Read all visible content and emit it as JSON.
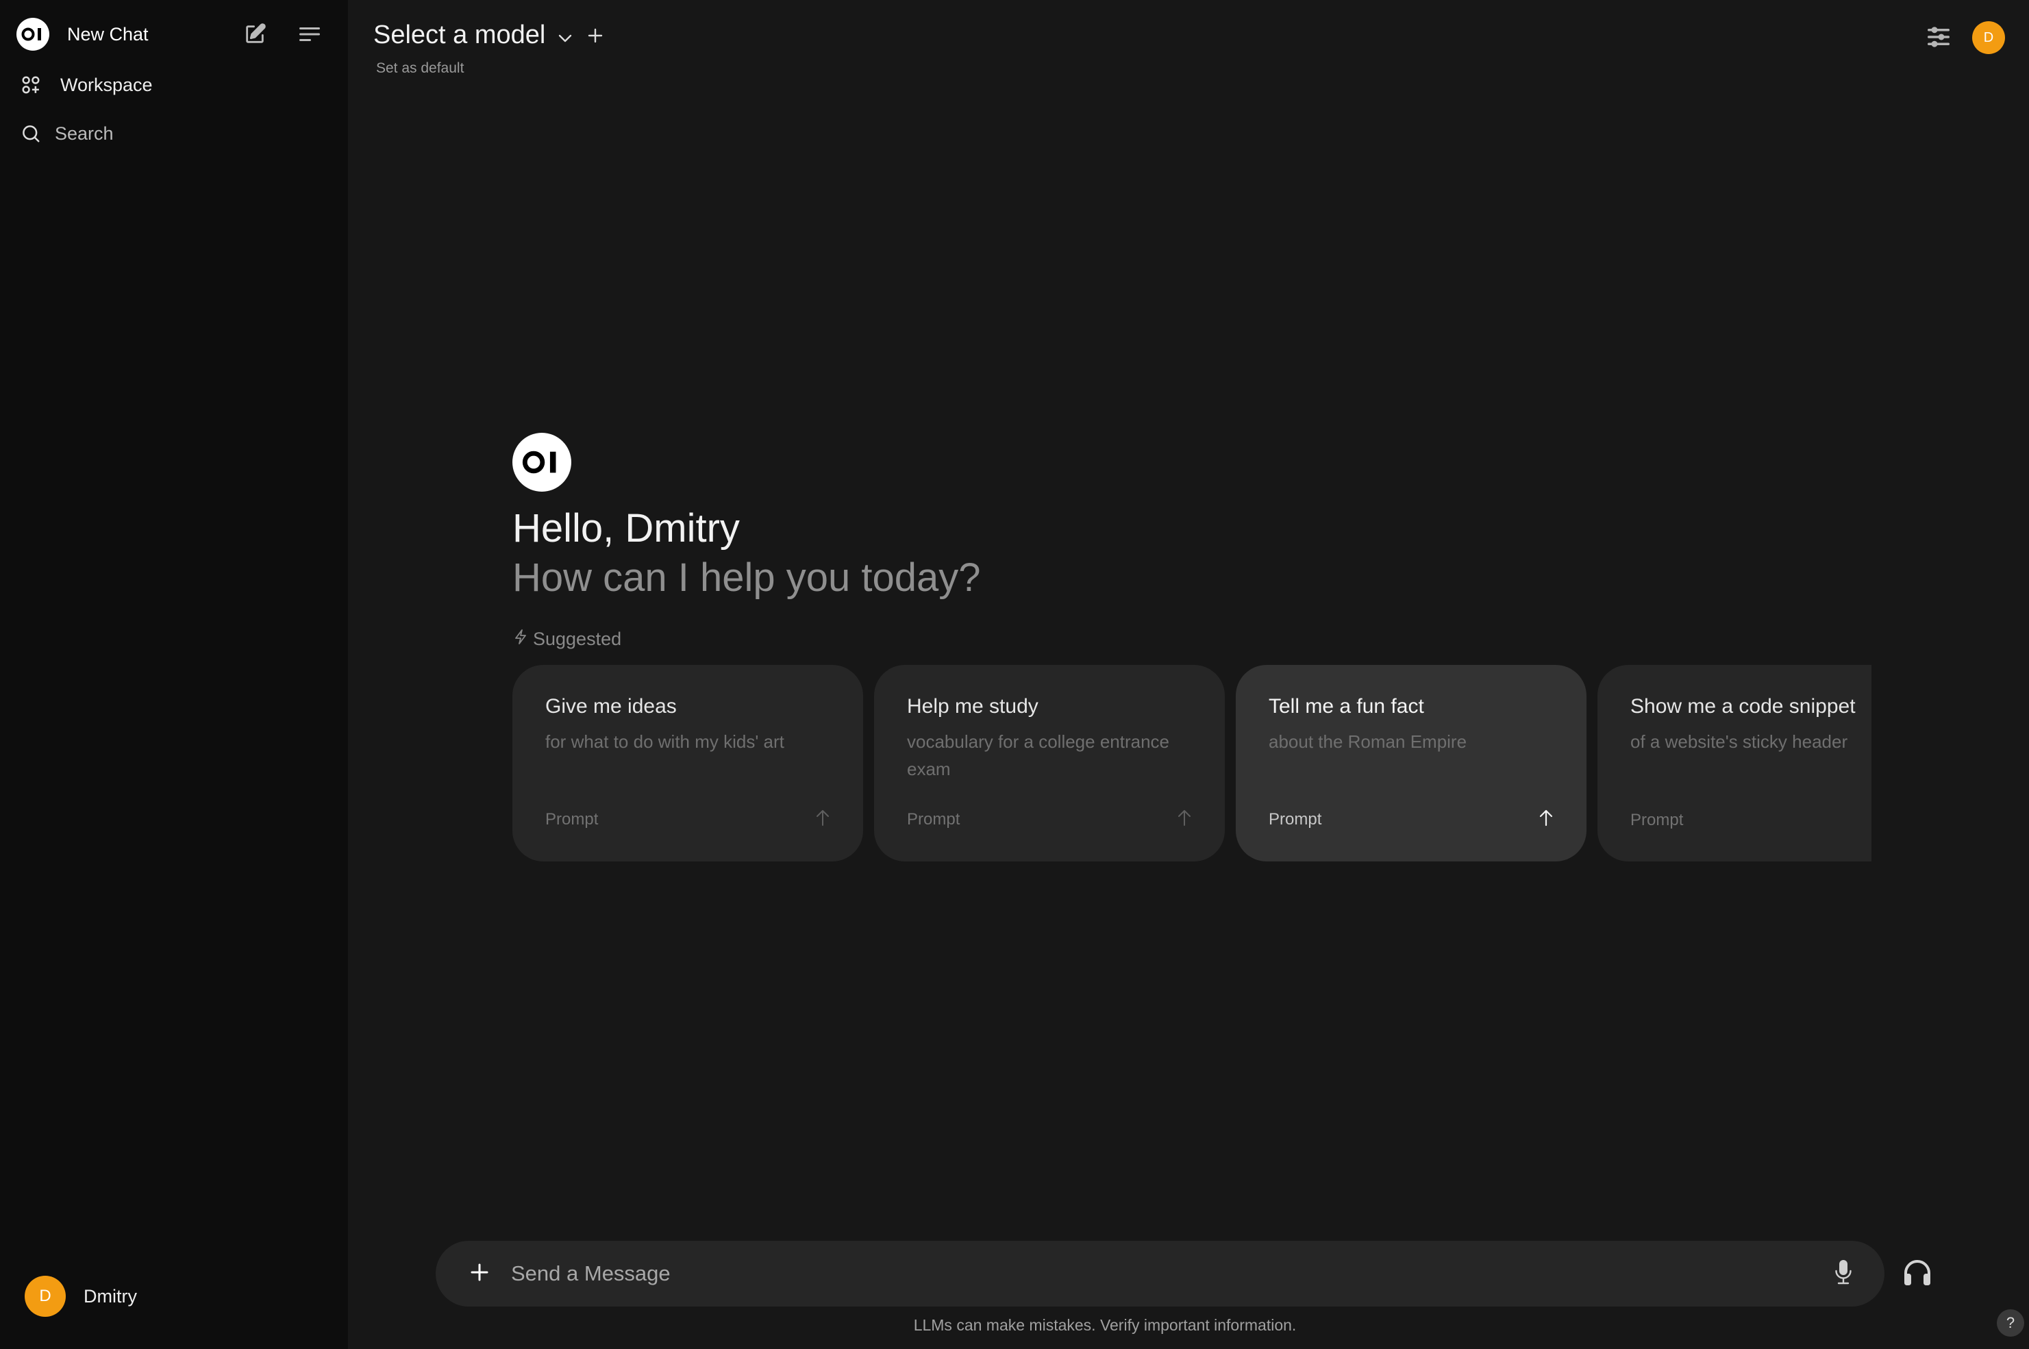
{
  "sidebar": {
    "new_chat_label": "New Chat",
    "items": [
      {
        "label": "Workspace",
        "icon": "workspace-icon"
      },
      {
        "label": "Search",
        "icon": "search-icon"
      }
    ],
    "user": {
      "name": "Dmitry",
      "initial": "D"
    }
  },
  "header": {
    "model_selector_label": "Select a model",
    "set_default_label": "Set as default",
    "user_initial": "D"
  },
  "welcome": {
    "greeting": "Hello, Dmitry",
    "subtitle": "How can I help you today?",
    "suggested_label": "Suggested"
  },
  "suggestions": [
    {
      "title": "Give me ideas",
      "subtitle": "for what to do with my kids' art",
      "tag": "Prompt"
    },
    {
      "title": "Help me study",
      "subtitle": "vocabulary for a college entrance exam",
      "tag": "Prompt"
    },
    {
      "title": "Tell me a fun fact",
      "subtitle": "about the Roman Empire",
      "tag": "Prompt"
    },
    {
      "title": "Show me a code snippet",
      "subtitle": "of a website's sticky header",
      "tag": "Prompt"
    }
  ],
  "composer": {
    "placeholder": "Send a Message",
    "value": ""
  },
  "footer": {
    "disclaimer": "LLMs can make mistakes. Verify important information.",
    "help_label": "?"
  },
  "colors": {
    "avatar": "#f39c12",
    "sidebar_bg": "#0d0d0d",
    "main_bg": "#171717",
    "card_bg": "#262626",
    "card_hover_bg": "#333333"
  }
}
